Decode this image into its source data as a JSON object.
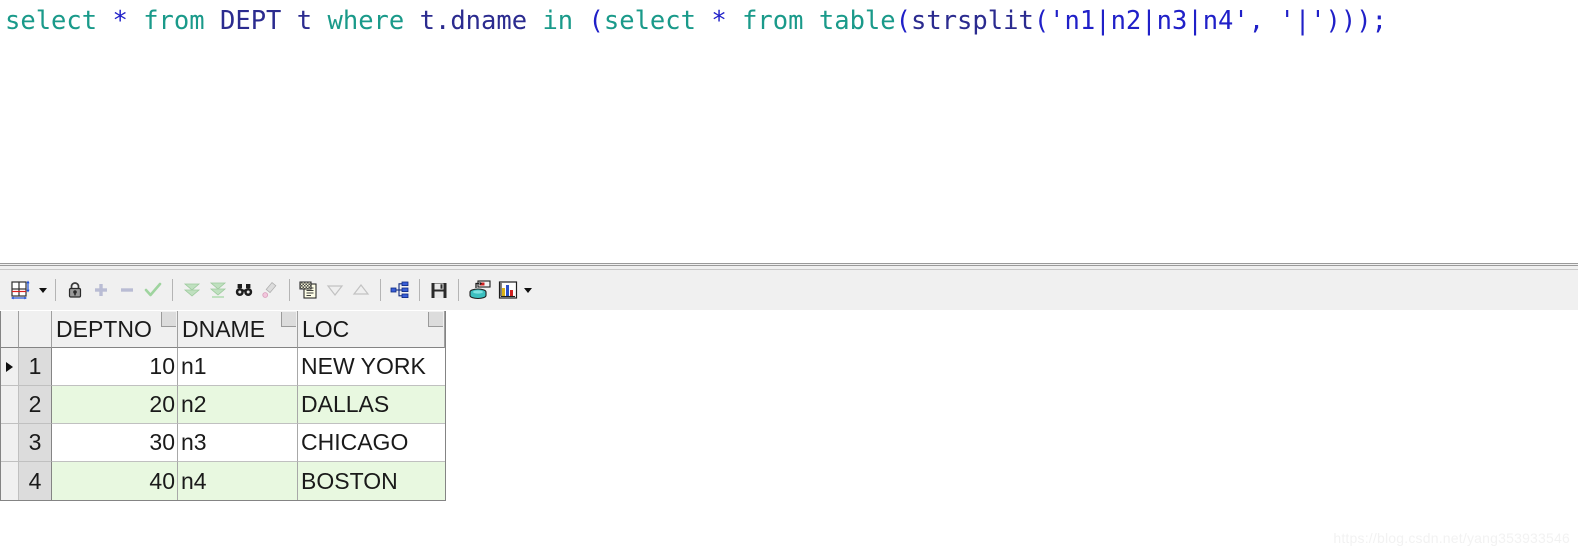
{
  "editor": {
    "sql_full": "select * from DEPT t where t.dname in (select * from table(strsplit('n1|n2|n3|n4', '|')));",
    "tokens": [
      {
        "text": "select",
        "color": "#1a9a8a"
      },
      {
        "text": " ",
        "color": "#101010"
      },
      {
        "text": "*",
        "color": "#2020c8"
      },
      {
        "text": " ",
        "color": "#101010"
      },
      {
        "text": "from",
        "color": "#1a9a8a"
      },
      {
        "text": " ",
        "color": "#101010"
      },
      {
        "text": "DEPT",
        "color": "#2b2b8f"
      },
      {
        "text": " ",
        "color": "#101010"
      },
      {
        "text": "t",
        "color": "#2b2b8f"
      },
      {
        "text": " ",
        "color": "#101010"
      },
      {
        "text": "where",
        "color": "#1a9a8a"
      },
      {
        "text": " ",
        "color": "#101010"
      },
      {
        "text": "t.dname",
        "color": "#2b2b8f"
      },
      {
        "text": " ",
        "color": "#101010"
      },
      {
        "text": "in",
        "color": "#1a9a8a"
      },
      {
        "text": " ",
        "color": "#101010"
      },
      {
        "text": "(",
        "color": "#2020c8"
      },
      {
        "text": "select",
        "color": "#1a9a8a"
      },
      {
        "text": " ",
        "color": "#101010"
      },
      {
        "text": "*",
        "color": "#2020c8"
      },
      {
        "text": " ",
        "color": "#101010"
      },
      {
        "text": "from",
        "color": "#1a9a8a"
      },
      {
        "text": " ",
        "color": "#101010"
      },
      {
        "text": "table",
        "color": "#1a9a8a"
      },
      {
        "text": "(",
        "color": "#2020c8"
      },
      {
        "text": "strsplit",
        "color": "#2b2b8f"
      },
      {
        "text": "(",
        "color": "#2020c8"
      },
      {
        "text": "'n1|n2|n3|n4'",
        "color": "#2020c8"
      },
      {
        "text": ", ",
        "color": "#2020c8"
      },
      {
        "text": "'|'",
        "color": "#2020c8"
      },
      {
        "text": ")));",
        "color": "#2020c8"
      }
    ]
  },
  "toolbar": {
    "items": [
      {
        "name": "grid-layout-icon",
        "label": "Grid layout",
        "enabled": true
      },
      {
        "name": "grid-layout-dropdown",
        "label": "Grid layout options",
        "enabled": true
      },
      {
        "name": "lock-icon",
        "label": "Lock record",
        "enabled": true
      },
      {
        "name": "add-row-icon",
        "label": "Insert record",
        "enabled": false
      },
      {
        "name": "remove-row-icon",
        "label": "Delete record",
        "enabled": false
      },
      {
        "name": "post-changes-icon",
        "label": "Post changes",
        "enabled": false
      },
      {
        "name": "fetch-next-page-icon",
        "label": "Fetch next page",
        "enabled": false
      },
      {
        "name": "fetch-all-icon",
        "label": "Fetch all rows",
        "enabled": false
      },
      {
        "name": "find-icon",
        "label": "Find",
        "enabled": true
      },
      {
        "name": "highlight-icon",
        "label": "Highlight",
        "enabled": false
      },
      {
        "name": "filter-icon",
        "label": "Filter data",
        "enabled": true
      },
      {
        "name": "sort-descending-icon",
        "label": "Sort descending",
        "enabled": false
      },
      {
        "name": "sort-ascending-icon",
        "label": "Sort ascending",
        "enabled": false
      },
      {
        "name": "hierarchy-icon",
        "label": "Show structure",
        "enabled": true
      },
      {
        "name": "save-icon",
        "label": "Export data",
        "enabled": true
      },
      {
        "name": "commit-icon",
        "label": "Commit",
        "enabled": true
      },
      {
        "name": "chart-icon",
        "label": "Chart",
        "enabled": true
      },
      {
        "name": "chart-dropdown",
        "label": "Chart options",
        "enabled": true
      }
    ]
  },
  "grid": {
    "columns": [
      "DEPTNO",
      "DNAME",
      "LOC"
    ],
    "rows": [
      {
        "num": "1",
        "DEPTNO": "10",
        "DNAME": "n1",
        "LOC": "NEW YORK",
        "current": true
      },
      {
        "num": "2",
        "DEPTNO": "20",
        "DNAME": "n2",
        "LOC": "DALLAS",
        "current": false
      },
      {
        "num": "3",
        "DEPTNO": "30",
        "DNAME": "n3",
        "LOC": "CHICAGO",
        "current": false
      },
      {
        "num": "4",
        "DEPTNO": "40",
        "DNAME": "n4",
        "LOC": "BOSTON",
        "current": false
      }
    ]
  },
  "watermark": {
    "text": "https://blog.csdn.net/yang353933546"
  }
}
